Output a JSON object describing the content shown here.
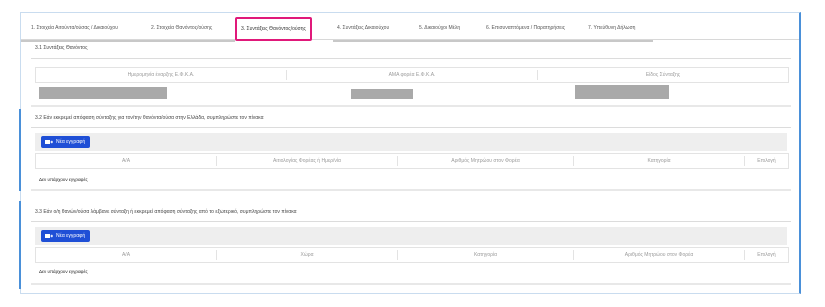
{
  "tabs": [
    {
      "label": "1. Στοιχεία Αιτούντα/ούσας / Δικαιούχου"
    },
    {
      "label": "2. Στοιχεία Θανόντος/ούσης"
    },
    {
      "label": "3. Συντάξεις Θανόντος/ούσης"
    },
    {
      "label": "4. Συντάξεις Δικαιούχου"
    },
    {
      "label": "5. Δικαιούχοι Μέλη"
    },
    {
      "label": "6. Επισυναπτόμενα / Παρατηρήσεις"
    },
    {
      "label": "7. Υπεύθυνη Δήλωση"
    }
  ],
  "section1": {
    "title": "3.1 Συντάξεις Θανόντος",
    "headers": [
      "Ημερομηνία έναρξης Ε.Φ.Κ.Α.",
      "ΑΜΑ φορέα Ε.Φ.Κ.Α.",
      "Είδος Σύνταξης"
    ]
  },
  "section2": {
    "title": "3.2 Εάν εκκρεμεί απόφαση σύνταξης για τον/την θανόντα/ούσα στην Ελλάδα, συμπληρώστε τον πίνακα",
    "button": "Νέα εγγραφή",
    "headers": [
      "Α/Α",
      "Αιτιολογίας Φορέας ή Ημερ/νία",
      "Αριθμός Μητρώου στον Φορέα",
      "Κατηγορία",
      "Επιλογή"
    ],
    "empty": "Δεν υπάρχουν εγγραφές"
  },
  "section3": {
    "title": "3.3 Εάν ο/η θανών/ούσα λάμβανε σύνταξη ή εκκρεμεί απόφαση σύνταξης από το εξωτερικό, συμπληρώστε τον πίνακα",
    "button": "Νέα εγγραφή",
    "headers": [
      "Α/Α",
      "Χώρα",
      "Κατηγορία",
      "Αριθμός Μητρώου στον Φορέα",
      "Επιλογή"
    ],
    "empty": "Δεν υπάρχουν εγγραφές"
  },
  "colors": {
    "accent": "#e0197a",
    "button": "#1f4fd6",
    "frame": "#4a90d9"
  }
}
